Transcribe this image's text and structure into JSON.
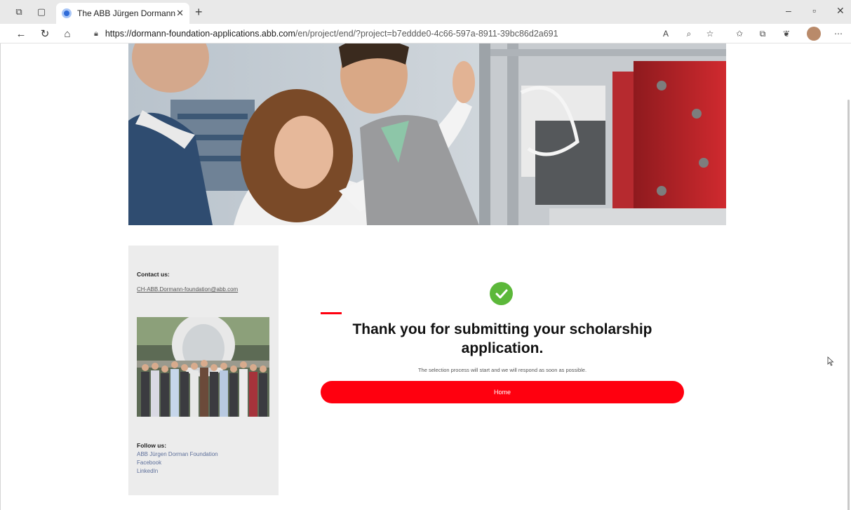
{
  "browser": {
    "tab_title": "The ABB Jürgen Dormann Found",
    "url_host": "https://dormann-foundation-applications.abb.com",
    "url_path": "/en/project/end/?project=b7eddde0-4c66-597a-8911-39bc86d2a691"
  },
  "sidebar": {
    "contact_title": "Contact us:",
    "contact_email": "CH-ABB.Dormann-foundation@abb.com",
    "follow_title": "Follow us:",
    "social_links": [
      "ABB Jürgen Dorman Foundation",
      "Facebook",
      "LinkedIn"
    ]
  },
  "main": {
    "title": "Thank you for submitting your scholarship application.",
    "subtitle": "The selection process will start and we will respond as soon as possible.",
    "home_button": "Home"
  },
  "colors": {
    "accent_red": "#ff000f",
    "success_green": "#5cb83a"
  }
}
